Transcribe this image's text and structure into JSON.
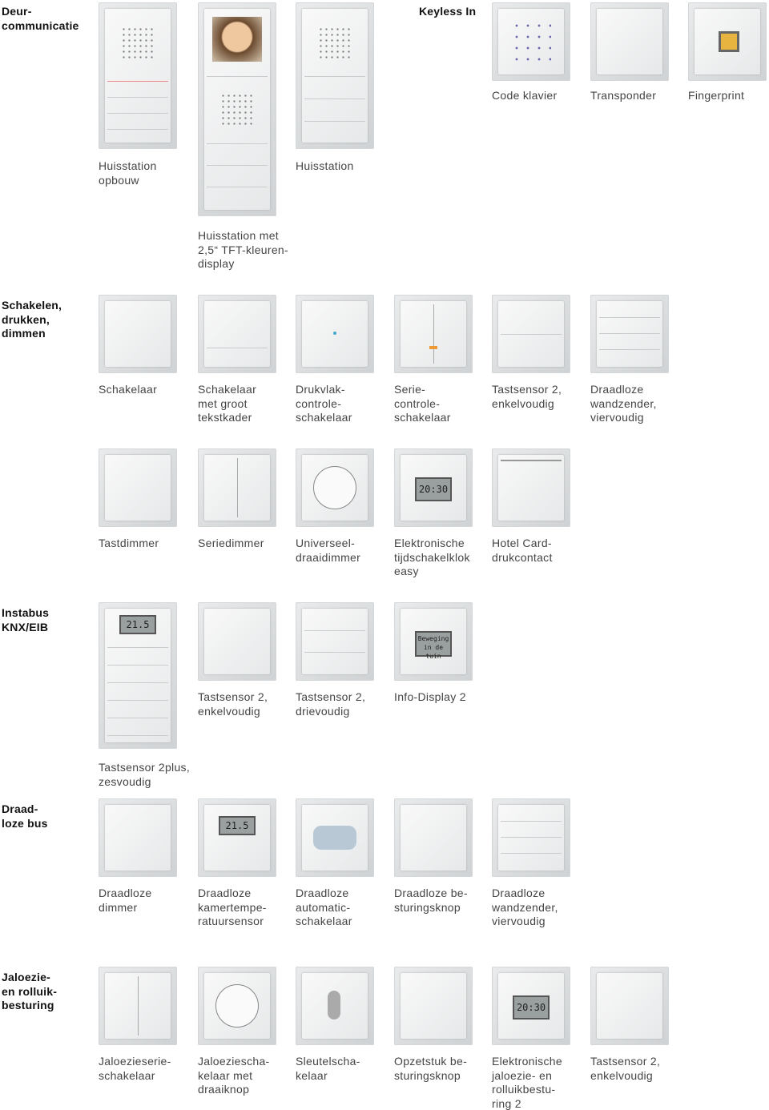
{
  "sections": {
    "deur": "Deur-\ncommunicatie",
    "keyless": "Keyless In",
    "schakelen": "Schakelen,\ndrukken,\ndimmen",
    "instabus": "Instabus\nKNX/EIB",
    "draadloos": "Draad-\nloze bus",
    "jaloezie": "Jaloezie-\nen rolluik-\nbesturing"
  },
  "products": {
    "huisstation_opbouw": "Huisstation\nopbouw",
    "huisstation_tft": "Huisstation met\n2,5“ TFT-kleuren-\ndisplay",
    "huisstation": "Huisstation",
    "code_klavier": "Code klavier",
    "transponder": "Transponder",
    "fingerprint": "Fingerprint",
    "schakelaar": "Schakelaar",
    "schakelaar_tekstkader": "Schakelaar\nmet groot\ntekstkader",
    "drukvlak": "Drukvlak-\ncontrole-\nschakelaar",
    "serie_controle": "Serie-\ncontrole-\nschakelaar",
    "tastsensor2_enkel_a": "Tastsensor 2,\nenkelvoudig",
    "draadloze_wandzender_a": "Draadloze\nwandzender,\nviervoudig",
    "tastdimmer": "Tastdimmer",
    "seriedimmer": "Seriedimmer",
    "universeel": "Universeel-\ndraaidimmer",
    "tijdschakelklok": "Elektronische\ntijdschakelklok\neasy",
    "hotelcard": "Hotel Card-\ndrukcontact",
    "tastsensor2plus": "Tastsensor 2plus,\nzesvoudig",
    "tastsensor2_enkel_b": "Tastsensor 2,\nenkelvoudig",
    "tastsensor2_drie": "Tastsensor 2,\ndrievoudig",
    "infodisplay": "Info-Display 2",
    "draadloze_dimmer": "Draadloze\ndimmer",
    "kamertemp": "Draadloze\nkamertempe-\nratuursensor",
    "automatic": "Draadloze\nautomatic-\nschakelaar",
    "besturingsknop": "Draadloze be-\nsturingsknop",
    "draadloze_wandzender_b": "Draadloze\nwandzender,\nviervoudig",
    "jaloezieserie": "Jaloezieserie-\nschakelaar",
    "jaloeziedraai": "Jaloeziescha-\nkelaar met\ndraaiknop",
    "sleutel": "Sleutelscha-\nkelaar",
    "opzetstuk": "Opzetstuk be-\nsturingsknop",
    "jaloezie_elektr": "Elektronische\njaloezie- en\nrolluikbestu-\nring 2",
    "tastsensor2_enkel_c": "Tastsensor 2,\nenkelvoudig"
  },
  "displays": {
    "clock": "20:30",
    "temp": "21.5",
    "info": "Beweging in de tuin",
    "jal_clock": "20:30"
  }
}
